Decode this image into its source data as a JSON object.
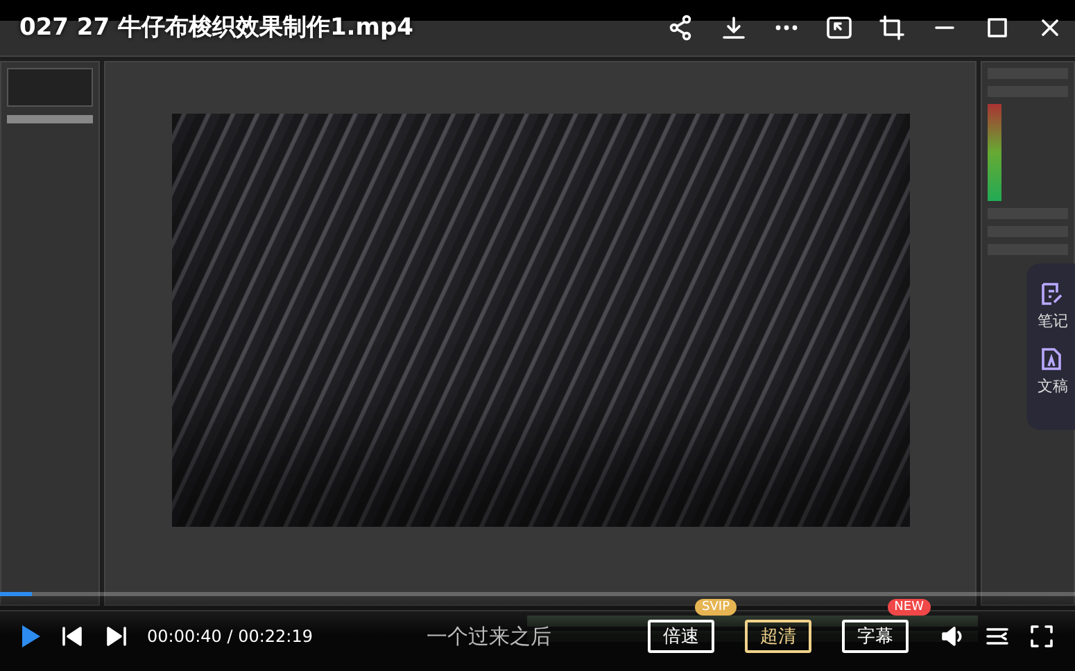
{
  "title": "027 27 牛仔布梭织效果制作1.mp4",
  "subtitle": "一个过来之后",
  "player": {
    "progress": {
      "level": 0.03
    },
    "time_current": "00:00:40",
    "time_total": "/ 00:22:19",
    "buttons": [
      {
        "label": "倍速",
        "highlighted": false,
        "badge": {
          "text": "SVIP",
          "color": "#e6b452"
        }
      },
      {
        "label": "超清",
        "highlighted": true
      },
      {
        "label": "字幕",
        "highlighted": false,
        "badge": {
          "text": "NEW",
          "color": "#f04848"
        }
      }
    ]
  },
  "side_panel": [
    {
      "kind": "note",
      "label": "笔记"
    },
    {
      "kind": "transcript",
      "label": "文稿"
    }
  ]
}
